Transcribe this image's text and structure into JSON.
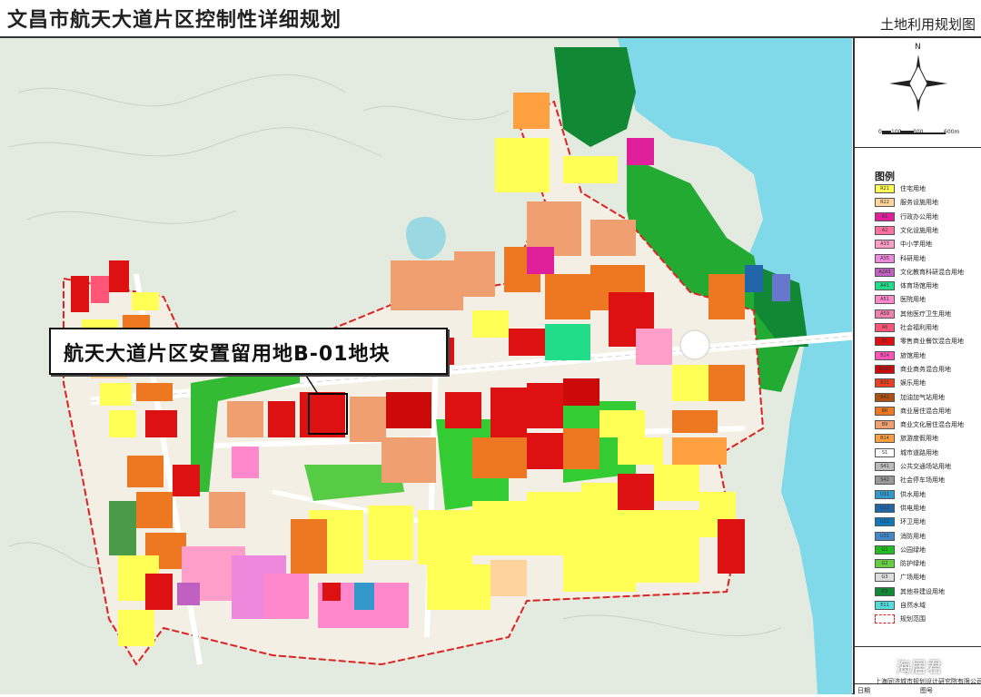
{
  "header": {
    "title": "文昌市航天大道片区控制性详细规划",
    "subtitle": "土地利用规划图"
  },
  "compass": {
    "north_label": "N",
    "scale_labels": [
      "0",
      "100",
      "300",
      "600m"
    ]
  },
  "callout": {
    "text": "航天大道片区安置留用地B-01地块"
  },
  "legend": {
    "title": "图例",
    "items": [
      {
        "code": "R21",
        "label": "住宅用地",
        "color": "#ffff55"
      },
      {
        "code": "R22",
        "label": "服务设施用地",
        "color": "#ffd39b"
      },
      {
        "code": "A1",
        "label": "行政办公用地",
        "color": "#e0209a"
      },
      {
        "code": "A2",
        "label": "文化设施用地",
        "color": "#ff6fa0"
      },
      {
        "code": "A33",
        "label": "中小学用地",
        "color": "#ff9ec8"
      },
      {
        "code": "A35",
        "label": "科研用地",
        "color": "#ee88dd"
      },
      {
        "code": "A2A3",
        "label": "文化教育科研混合用地",
        "color": "#c060c0"
      },
      {
        "code": "A41",
        "label": "体育场馆用地",
        "color": "#22dd88"
      },
      {
        "code": "A51",
        "label": "医院用地",
        "color": "#ff88cc"
      },
      {
        "code": "A59",
        "label": "其他医疗卫生用地",
        "color": "#f080b0"
      },
      {
        "code": "A6",
        "label": "社会福利用地",
        "color": "#ff5577"
      },
      {
        "code": "B1",
        "label": "零售商业餐饮混合用地",
        "color": "#dd1111"
      },
      {
        "code": "B14",
        "label": "旅馆用地",
        "color": "#ff55bb"
      },
      {
        "code": "B1B2",
        "label": "商业商务混合用地",
        "color": "#cc0a0a"
      },
      {
        "code": "B31",
        "label": "娱乐用地",
        "color": "#e84020"
      },
      {
        "code": "B41",
        "label": "加油加气站用地",
        "color": "#b05010"
      },
      {
        "code": "BR",
        "label": "商业居住混合用地",
        "color": "#ee7722"
      },
      {
        "code": "B9",
        "label": "商业文化居住混合用地",
        "color": "#f0a070"
      },
      {
        "code": "B14",
        "label": "旅游度假用地",
        "color": "#ffa040"
      },
      {
        "code": "S1",
        "label": "城市道路用地",
        "color": "#ffffff"
      },
      {
        "code": "S41",
        "label": "公共交通场站用地",
        "color": "#bbbbbb"
      },
      {
        "code": "S42",
        "label": "社会停车场用地",
        "color": "#999999"
      },
      {
        "code": "U11",
        "label": "供水用地",
        "color": "#3399cc"
      },
      {
        "code": "U12",
        "label": "供电用地",
        "color": "#2266aa"
      },
      {
        "code": "U22",
        "label": "环卫用地",
        "color": "#1177bb"
      },
      {
        "code": "U31",
        "label": "消防用地",
        "color": "#4488cc"
      },
      {
        "code": "G1",
        "label": "公园绿地",
        "color": "#22bb22"
      },
      {
        "code": "G2",
        "label": "防护绿地",
        "color": "#66cc44"
      },
      {
        "code": "G3",
        "label": "广场用地",
        "color": "#dddddd"
      },
      {
        "code": "E9",
        "label": "其他非建设用地",
        "color": "#118833"
      },
      {
        "code": "E11",
        "label": "自然水域",
        "color": "#55dddd"
      },
      {
        "code": "",
        "label": "规划范围",
        "color": "#dd2222"
      }
    ]
  },
  "footer": {
    "watermark": "海居君",
    "company": "上海同济城市规划设计研究院有限公司",
    "date_label": "日期",
    "drawing_no_label": "图号"
  }
}
